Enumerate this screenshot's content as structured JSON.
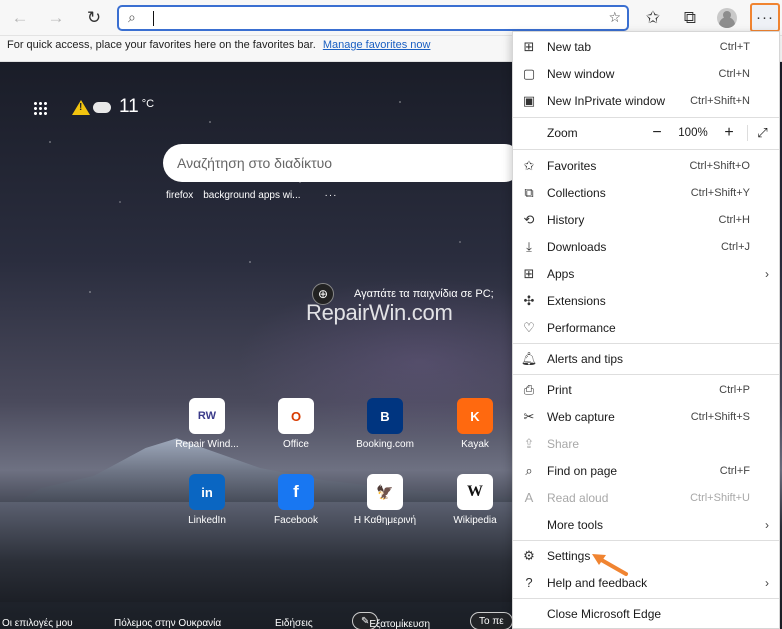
{
  "favbar": {
    "message": "For quick access, place your favorites here on the favorites bar.",
    "manage_link": "Manage favorites now"
  },
  "toolbar": {
    "address_value": "",
    "more_button_label": "···"
  },
  "ntp": {
    "weather": {
      "temp": "11",
      "unit": "°C"
    },
    "search_placeholder": "Αναζήτηση στο διαδίκτυο",
    "recent_searches": [
      "firefox",
      "background apps wi..."
    ],
    "recent_more": "···",
    "game_promo": "Αγαπάτε τα παιχνίδια σε PC;",
    "watermark": "RepairWin.com",
    "tiles": [
      {
        "label": "Repair Wind...",
        "glyph": "RW",
        "color": "#3b3b8a"
      },
      {
        "label": "Office",
        "glyph": "O",
        "color": "#d83b01"
      },
      {
        "label": "Booking.com",
        "glyph": "B",
        "color": "#003580"
      },
      {
        "label": "Kayak",
        "glyph": "K",
        "color": "#ff690f"
      },
      {
        "label": "LinkedIn",
        "glyph": "in",
        "color": "#0a66c2"
      },
      {
        "label": "Facebook",
        "glyph": "f",
        "color": "#1877f2"
      },
      {
        "label": "Η Καθημερινή",
        "glyph": "🦅",
        "color": "#222222"
      },
      {
        "label": "Wikipedia",
        "glyph": "W",
        "color": "#111111"
      }
    ],
    "bottom": {
      "item1": "Οι επιλογές μου",
      "item2": "Πόλεμος στην Ουκρανία",
      "item3": "Ειδήσεις",
      "pill1": "Εξατομίκευση",
      "pill2": "Το πε"
    }
  },
  "menu": {
    "new_tab": {
      "label": "New tab",
      "shortcut": "Ctrl+T"
    },
    "new_window": {
      "label": "New window",
      "shortcut": "Ctrl+N"
    },
    "new_inprivate": {
      "label": "New InPrivate window",
      "shortcut": "Ctrl+Shift+N"
    },
    "zoom": {
      "label": "Zoom",
      "minus": "−",
      "value": "100%",
      "plus": "+",
      "fullscreen": "⤢"
    },
    "favorites": {
      "label": "Favorites",
      "shortcut": "Ctrl+Shift+O"
    },
    "collections": {
      "label": "Collections",
      "shortcut": "Ctrl+Shift+Y"
    },
    "history": {
      "label": "History",
      "shortcut": "Ctrl+H"
    },
    "downloads": {
      "label": "Downloads",
      "shortcut": "Ctrl+J"
    },
    "apps": {
      "label": "Apps"
    },
    "extensions": {
      "label": "Extensions"
    },
    "performance": {
      "label": "Performance"
    },
    "alerts": {
      "label": "Alerts and tips"
    },
    "print": {
      "label": "Print",
      "shortcut": "Ctrl+P"
    },
    "web_capture": {
      "label": "Web capture",
      "shortcut": "Ctrl+Shift+S"
    },
    "share": {
      "label": "Share"
    },
    "find": {
      "label": "Find on page",
      "shortcut": "Ctrl+F"
    },
    "read_aloud": {
      "label": "Read aloud",
      "shortcut": "Ctrl+Shift+U"
    },
    "more_tools": {
      "label": "More tools"
    },
    "settings": {
      "label": "Settings"
    },
    "help": {
      "label": "Help and feedback"
    },
    "close": {
      "label": "Close Microsoft Edge"
    }
  },
  "colors": {
    "accent_border": "#3a6fd1",
    "highlight_arrow": "#f08431"
  }
}
